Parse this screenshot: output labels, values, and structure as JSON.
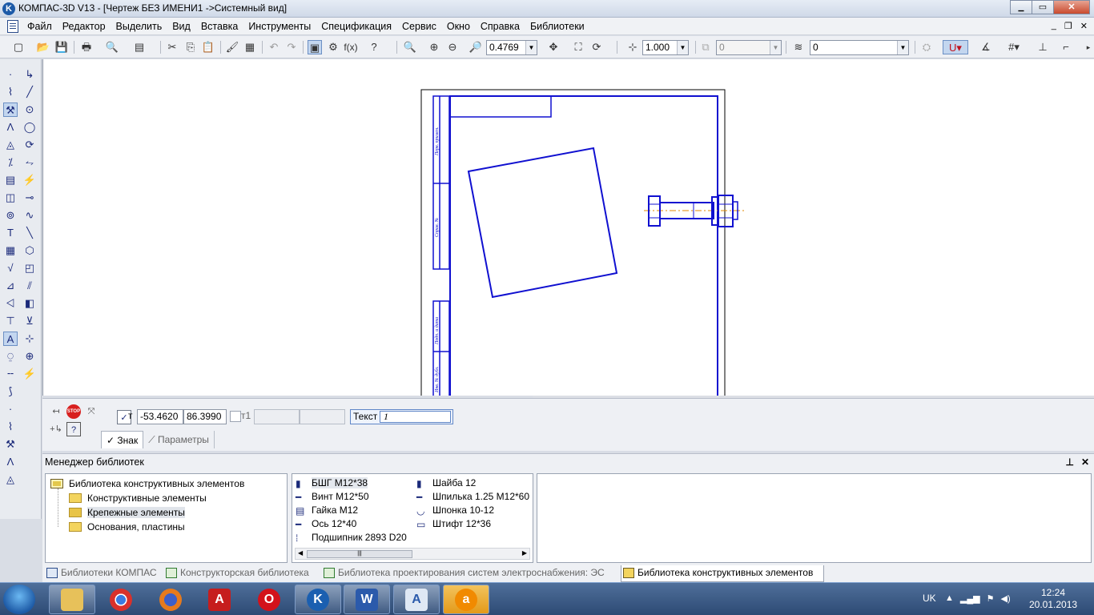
{
  "window": {
    "title": "КОМПАС-3D V13 - [Чертеж БЕЗ ИМЕНИ1 ->Системный вид]",
    "controls": {
      "minimize": "▭",
      "maximize": "▭",
      "close": "✕"
    },
    "mdi_controls": {
      "minimize": "_",
      "restore": "❐",
      "close": "✕"
    }
  },
  "menu": {
    "items": [
      "Файл",
      "Редактор",
      "Выделить",
      "Вид",
      "Вставка",
      "Инструменты",
      "Спецификация",
      "Сервис",
      "Окно",
      "Справка",
      "Библиотеки"
    ]
  },
  "toolbar": {
    "zoom_value": "0.4769",
    "step_value": "1.000",
    "state_value": "0",
    "layer_value": "0",
    "icons": [
      "new-icon",
      "open-icon",
      "save-icon",
      "print-icon",
      "preview-icon",
      "cut-icon",
      "copy-icon",
      "paste-icon",
      "format-painter-icon",
      "properties-icon",
      "undo-icon",
      "redo-icon",
      "manager-icon",
      "variables-icon",
      "fx-icon",
      "help-icon",
      "zoom-icon",
      "zoom-in-icon",
      "zoom-out-icon",
      "pan-icon",
      "refresh-icon",
      "cursor-step-icon",
      "layers-icon",
      "snap-icon",
      "grid-icon",
      "ortho-icon",
      "local-cs-icon"
    ]
  },
  "left_panel": {
    "icons": [
      "geometry-icon",
      "dimensions-icon",
      "designations-icon",
      "editing-icon",
      "parametrization-icon",
      "measure-icon",
      "select-icon",
      "spec-icon",
      "reports-icon",
      "insert-icon",
      "lines-icon",
      "circle-icon",
      "arc-icon",
      "ellipse-icon",
      "spline-icon",
      "polygon-icon",
      "hatch-icon",
      "text-icon",
      "table-icon",
      "roughness-icon",
      "leader-icon",
      "tolerance-icon"
    ]
  },
  "drawing": {
    "sheet_side_labels": [
      "Перв. примен.",
      "Справ. №",
      "Подп. и дата",
      "Инв. № дубл."
    ]
  },
  "property_bar": {
    "point_label": "т",
    "x_value": "-53.4620",
    "y_value": "86.3990",
    "point2_label": "т1",
    "text_label": "Текст",
    "text_value": "1",
    "tabs": [
      "Знак",
      "Параметры"
    ]
  },
  "library_manager": {
    "title": "Менеджер библиотек",
    "pin": "📌",
    "close": "✕",
    "tree": {
      "root": "Библиотека конструктивных элементов",
      "children": [
        "Конструктивные элементы",
        "Крепежные элементы",
        "Основания, пластины"
      ]
    },
    "items_col1": [
      "БШГ М12*38",
      "Винт М12*50",
      "Гайка М12",
      "Ось 12*40",
      "Подшипник 2893  D20"
    ],
    "items_col2": [
      "Шайба 12",
      "Шпилька 1.25  М12*60",
      "Шпонка 10-12",
      "Штифт 12*36"
    ]
  },
  "library_tabs": [
    "Библиотеки КОМПАС",
    "Конструкторская библиотека",
    "Библиотека проектирования систем электроснабжения: ЭС",
    "Библиотека конструктивных элементов"
  ],
  "taskbar": {
    "apps": [
      "explorer",
      "chrome",
      "firefox",
      "acrobat",
      "opera",
      "kompas",
      "word",
      "notepad",
      "avast"
    ],
    "lang": "UK",
    "time": "12:24",
    "date": "20.01.2013"
  }
}
